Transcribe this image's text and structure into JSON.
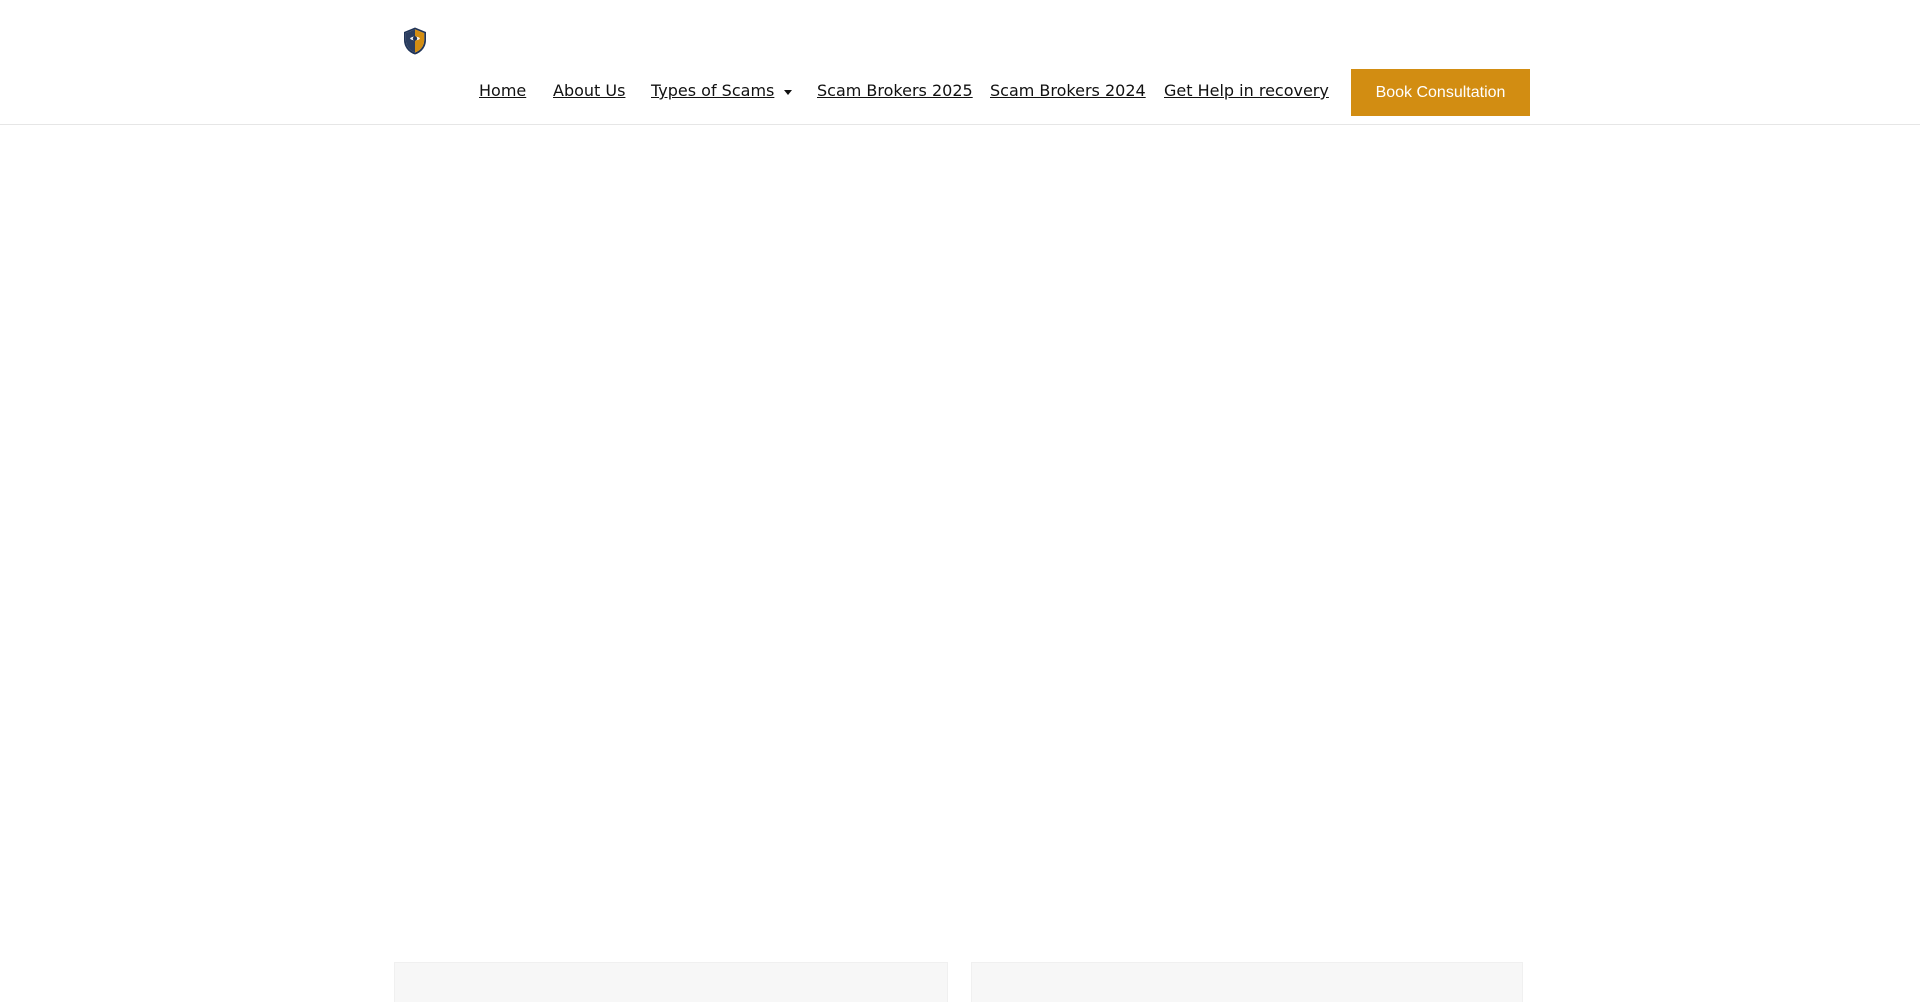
{
  "header": {
    "logo_icon": "shield-logo-icon",
    "nav": {
      "home": "Home",
      "about": "About Us",
      "types": "Types of Scams",
      "brokers_2025": "Scam Brokers 2025",
      "brokers_2024": "Scam Brokers 2024",
      "help": "Get Help in recovery"
    },
    "cta": "Book Consultation"
  },
  "colors": {
    "accent": "#d28d12",
    "text": "#111111",
    "border": "#e6e6e6",
    "card_bg": "#f7f7f7"
  },
  "cards": [
    {
      "title": ""
    },
    {
      "title": ""
    }
  ]
}
